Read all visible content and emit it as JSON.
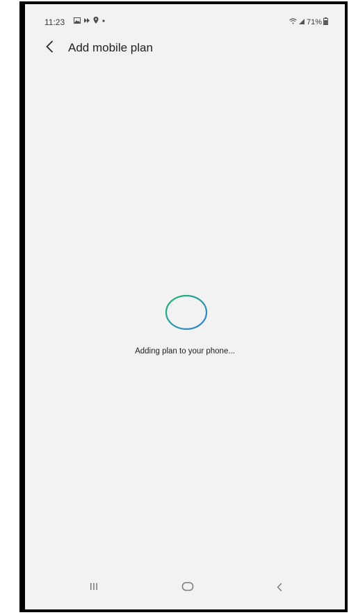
{
  "status_bar": {
    "time": "11:23",
    "battery": "71%",
    "left_icons": [
      "gallery-icon",
      "media-icon",
      "location-icon",
      "dot-icon"
    ],
    "right_icons": [
      "wifi-icon",
      "signal-icon",
      "battery-icon"
    ]
  },
  "header": {
    "title": "Add mobile plan",
    "back_icon": "back-arrow-icon"
  },
  "main": {
    "spinner_colors": [
      "#1fb86a",
      "#2f7ee0"
    ],
    "message": "Adding plan to your phone..."
  },
  "nav_bar": {
    "items": [
      "recents-icon",
      "home-icon",
      "back-icon"
    ]
  }
}
